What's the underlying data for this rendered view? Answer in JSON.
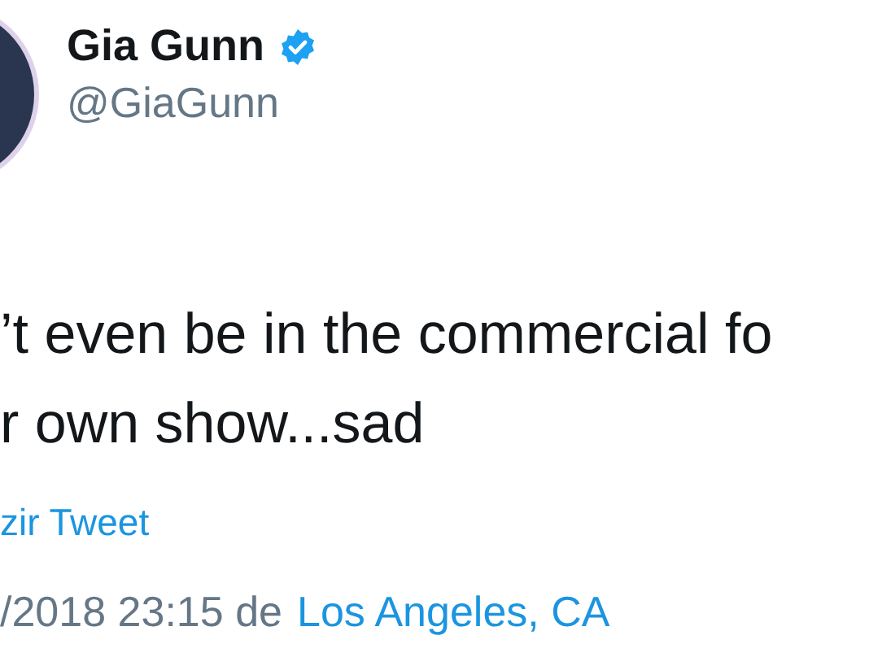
{
  "author": {
    "name": "Gia Gunn",
    "verified": true,
    "handle": "@GiaGunn"
  },
  "tweet": {
    "lines": [
      "’t even be in the commercial fo",
      "r own show...sad"
    ]
  },
  "translate_link": "zir Tweet",
  "meta": {
    "timestamp": "/2018 23:15 de",
    "location": "Los Angeles, CA"
  }
}
